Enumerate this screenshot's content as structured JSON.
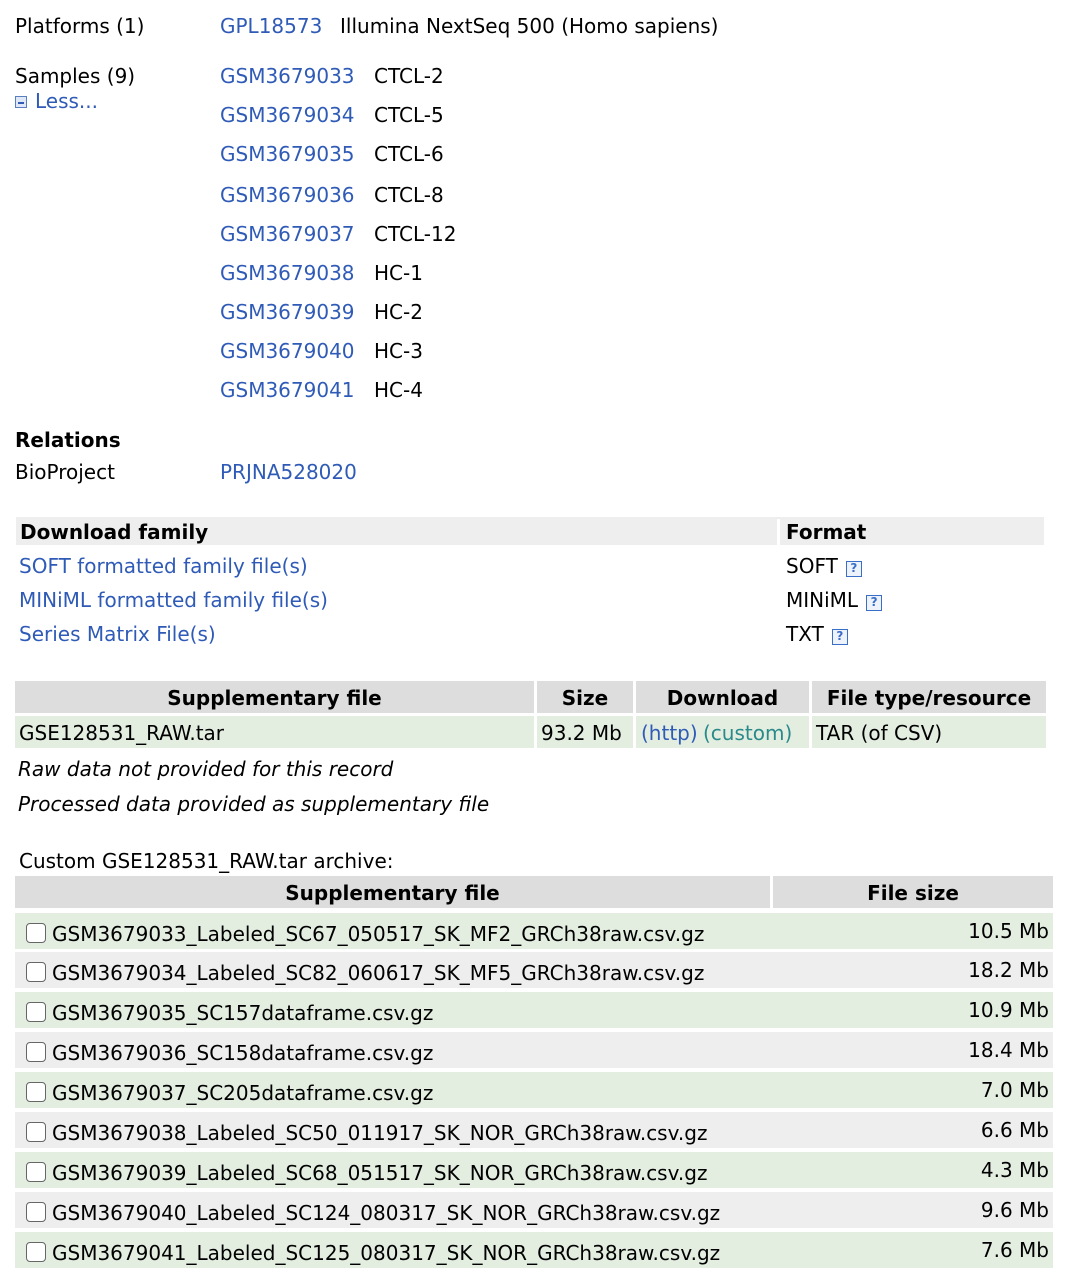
{
  "platforms": {
    "label": "Platforms (1)",
    "items": [
      {
        "accession": "GPL18573",
        "title": "Illumina NextSeq 500 (Homo sapiens)"
      }
    ]
  },
  "samples": {
    "label": "Samples (9)",
    "less_label": "Less...",
    "items": [
      {
        "accession": "GSM3679033",
        "title": "CTCL-2"
      },
      {
        "accession": "GSM3679034",
        "title": "CTCL-5"
      },
      {
        "accession": "GSM3679035",
        "title": "CTCL-6"
      },
      {
        "accession": "GSM3679036",
        "title": "CTCL-8"
      },
      {
        "accession": "GSM3679037",
        "title": "CTCL-12"
      },
      {
        "accession": "GSM3679038",
        "title": "HC-1"
      },
      {
        "accession": "GSM3679039",
        "title": "HC-2"
      },
      {
        "accession": "GSM3679040",
        "title": "HC-3"
      },
      {
        "accession": "GSM3679041",
        "title": "HC-4"
      }
    ]
  },
  "relations": {
    "heading": "Relations",
    "bioproject_label": "BioProject",
    "bioproject_value": "PRJNA528020"
  },
  "download_family": {
    "header": "Download family",
    "format_header": "Format",
    "help_glyph": "?",
    "rows": [
      {
        "label": "SOFT formatted family file(s)",
        "format": "SOFT"
      },
      {
        "label": "MINiML formatted family file(s)",
        "format": "MINiML"
      },
      {
        "label": "Series Matrix File(s)",
        "format": "TXT"
      }
    ]
  },
  "supplementary": {
    "headers": [
      "Supplementary file",
      "Size",
      "Download",
      "File type/resource"
    ],
    "row": {
      "file": "GSE128531_RAW.tar",
      "size": "93.2 Mb",
      "http": "(http)",
      "custom": "(custom)",
      "type": "TAR (of CSV)"
    },
    "note1": "Raw data not provided for this record",
    "note2": "Processed data provided as supplementary file"
  },
  "archive": {
    "caption": "Custom GSE128531_RAW.tar archive:",
    "headers": [
      "Supplementary file",
      "File size"
    ],
    "files": [
      {
        "name": "GSM3679033_Labeled_SC67_050517_SK_MF2_GRCh38raw.csv.gz",
        "size": "10.5 Mb"
      },
      {
        "name": "GSM3679034_Labeled_SC82_060617_SK_MF5_GRCh38raw.csv.gz",
        "size": "18.2 Mb"
      },
      {
        "name": "GSM3679035_SC157dataframe.csv.gz",
        "size": "10.9 Mb"
      },
      {
        "name": "GSM3679036_SC158dataframe.csv.gz",
        "size": "18.4 Mb"
      },
      {
        "name": "GSM3679037_SC205dataframe.csv.gz",
        "size": "7.0 Mb"
      },
      {
        "name": "GSM3679038_Labeled_SC50_011917_SK_NOR_GRCh38raw.csv.gz",
        "size": "6.6 Mb"
      },
      {
        "name": "GSM3679039_Labeled_SC68_051517_SK_NOR_GRCh38raw.csv.gz",
        "size": "4.3 Mb"
      },
      {
        "name": "GSM3679040_Labeled_SC124_080317_SK_NOR_GRCh38raw.csv.gz",
        "size": "9.6 Mb"
      },
      {
        "name": "GSM3679041_Labeled_SC125_080317_SK_NOR_GRCh38raw.csv.gz",
        "size": "7.6 Mb"
      }
    ]
  },
  "colors": {
    "link": "#2f5bb7",
    "custom_link": "#2a8a8a",
    "green_row": "#e3eee1",
    "gray_row": "#eeeeee",
    "header_bg": "#dddddd"
  }
}
